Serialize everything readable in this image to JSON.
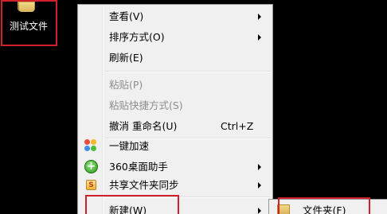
{
  "desktop": {
    "icon_label": "测试文件"
  },
  "context_menu": {
    "items": [
      {
        "label": "查看(V)",
        "submenu": true,
        "enabled": true
      },
      {
        "label": "排序方式(O)",
        "submenu": true,
        "enabled": true
      },
      {
        "label": "刷新(E)",
        "submenu": false,
        "enabled": true
      },
      {
        "label": "粘贴(P)",
        "submenu": false,
        "enabled": false
      },
      {
        "label": "粘贴快捷方式(S)",
        "submenu": false,
        "enabled": false
      },
      {
        "label": "撤消 重命名(U)",
        "shortcut": "Ctrl+Z",
        "submenu": false,
        "enabled": true
      },
      {
        "label": "一键加速",
        "icon": "speedup-icon",
        "submenu": false,
        "enabled": true
      },
      {
        "label": "360桌面助手",
        "icon": "360-desktop-assistant-icon",
        "submenu": true,
        "enabled": true
      },
      {
        "label": "共享文件夹同步",
        "icon": "share-sync-icon",
        "submenu": true,
        "enabled": true
      },
      {
        "label": "新建(W)",
        "submenu": true,
        "enabled": true,
        "highlighted_by_annotation": true
      }
    ]
  },
  "new_submenu": {
    "items": [
      {
        "label": "文件夹(F)",
        "icon": "folder-icon"
      }
    ]
  },
  "annotation": {
    "box_color": "#d0202a"
  }
}
